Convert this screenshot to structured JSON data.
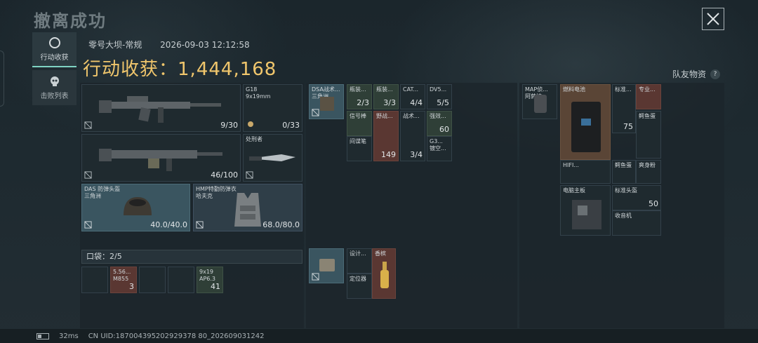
{
  "header": {
    "title": "撤离成功",
    "close_label": "×"
  },
  "sidebar": {
    "tabs": [
      {
        "label": "行动收获",
        "active": true
      },
      {
        "label": "击败列表",
        "active": false
      }
    ]
  },
  "raid": {
    "map": "零号大坝-常规",
    "datetime": "2026-09-03 12:12:58",
    "loot_label": "行动收获：",
    "loot_value": "1,444,168"
  },
  "teammate": {
    "label": "队友物资",
    "help": "?"
  },
  "gear": {
    "primary": {
      "value": "9/30"
    },
    "sidearm": {
      "name": "G18",
      "sub": "9x19mm",
      "value": "0/33"
    },
    "secondary": {
      "value": "46/100"
    },
    "melee": {
      "name": "处刑者"
    },
    "helmet": {
      "name": "DAS 防弹头盔",
      "sub": "三角洲",
      "value": "40.0/40.0"
    },
    "armor": {
      "name": "HMP特勤防弹衣",
      "sub": "哈夫克",
      "value": "68.0/80.0"
    }
  },
  "pocket": {
    "label": "口袋：",
    "used": "2",
    "slash": "/",
    "capacity": "5",
    "items": [
      {
        "name": "",
        "value": ""
      },
      {
        "name": "5.56...",
        "sub": "M855",
        "value": "3"
      },
      {
        "name": "",
        "value": ""
      },
      {
        "name": "",
        "value": ""
      },
      {
        "name": "9x19",
        "sub": "AP6.3",
        "value": "41"
      }
    ]
  },
  "rig": {
    "name": "DSA战术...",
    "sub": "三角洲",
    "items": [
      {
        "name": "瓶装...",
        "value": "2/3"
      },
      {
        "name": "瓶装...",
        "value": "3/3"
      },
      {
        "name": "CAT...",
        "value": "4/4"
      },
      {
        "name": "DV5...",
        "value": "5/5"
      },
      {
        "name": "信号棒",
        "value": ""
      },
      {
        "name": "野战...",
        "value": ""
      },
      {
        "name": "战术...",
        "value": ""
      },
      {
        "name": "强效...",
        "value": "60"
      },
      {
        "name": "间谍笔",
        "value": ""
      },
      {
        "name": "",
        "value": "149"
      },
      {
        "name": "",
        "value": "3/4"
      },
      {
        "name": "G3...",
        "sub": "镀空...",
        "value": ""
      }
    ]
  },
  "secure": {
    "items": [
      {
        "name": "设计...",
        "value": ""
      },
      {
        "name": "香槟",
        "value": ""
      },
      {
        "name": "定位器",
        "value": ""
      }
    ]
  },
  "backpack": {
    "name": "MAP侦...",
    "sub": "阿萨拉",
    "items": [
      {
        "name": "燃料电池",
        "value": ""
      },
      {
        "name": "标准...",
        "value": ""
      },
      {
        "name": "专业...",
        "value": ""
      },
      {
        "name": "",
        "value": "75"
      },
      {
        "name": "鳄鱼蛋",
        "value": ""
      },
      {
        "name": "HIFI...",
        "value": ""
      },
      {
        "name": "鳄鱼蛋",
        "value": ""
      },
      {
        "name": "爽身粉",
        "value": ""
      },
      {
        "name": "电脑主板",
        "value": ""
      },
      {
        "name": "标准头盔",
        "value": "50"
      },
      {
        "name": "收音机",
        "value": ""
      }
    ]
  },
  "footer": {
    "ping": "32ms",
    "uid": "CN UID:187004395202929378 80_202609031242"
  },
  "colors": {
    "gold": "#f0c66c",
    "accent": "#7fd3c3"
  }
}
